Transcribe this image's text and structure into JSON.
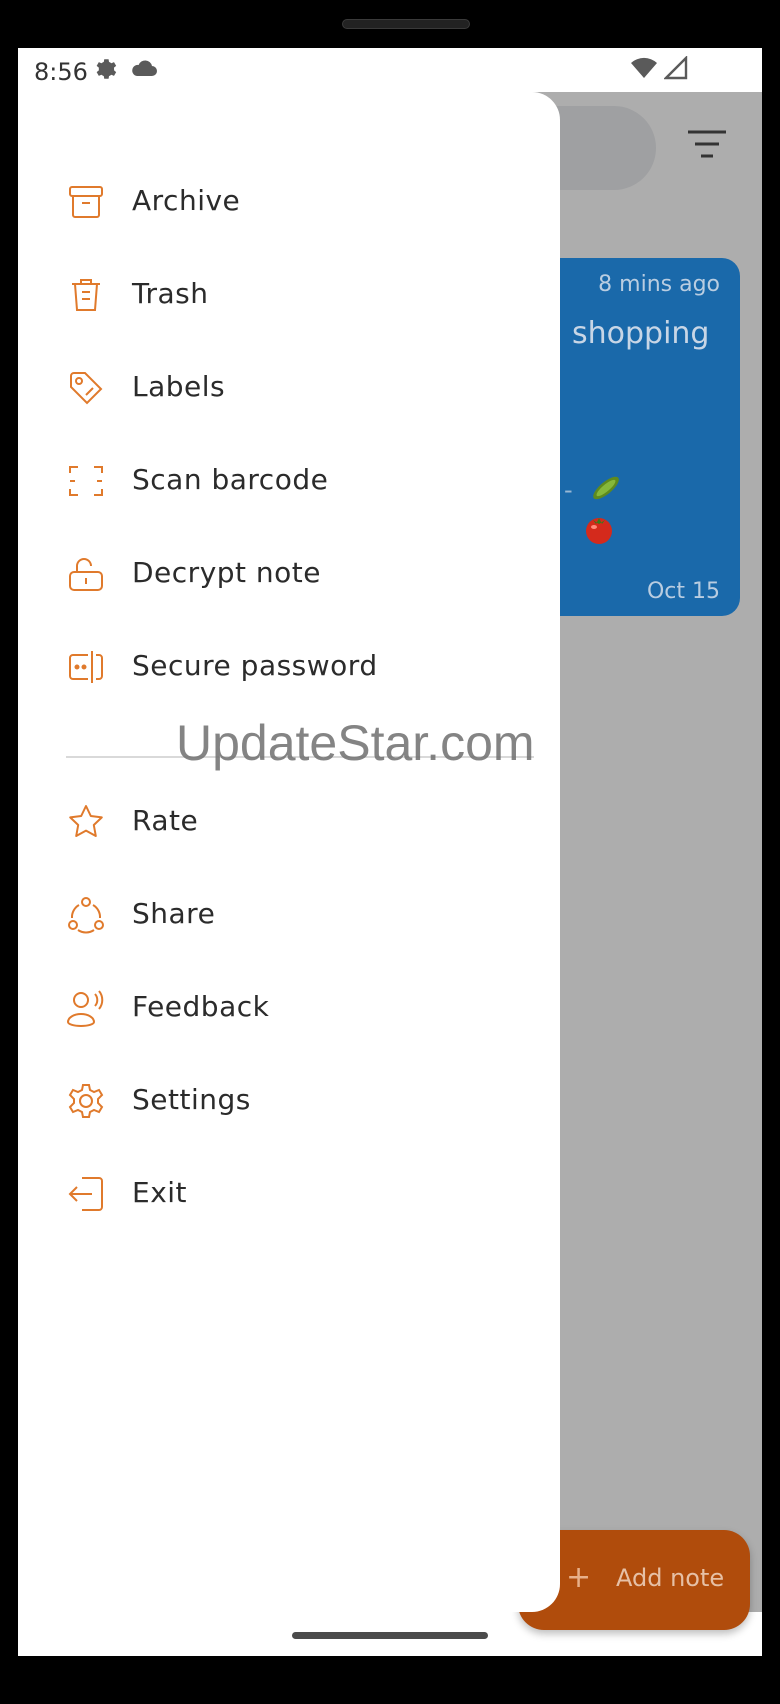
{
  "status": {
    "time": "8:56"
  },
  "menu": {
    "primary": [
      {
        "label": "Archive",
        "icon": "archive-icon"
      },
      {
        "label": "Trash",
        "icon": "trash-icon"
      },
      {
        "label": "Labels",
        "icon": "tag-icon"
      },
      {
        "label": "Scan barcode",
        "icon": "barcode-scan-icon"
      },
      {
        "label": "Decrypt note",
        "icon": "unlock-icon"
      },
      {
        "label": "Secure password",
        "icon": "password-icon"
      }
    ],
    "secondary": [
      {
        "label": "Rate",
        "icon": "star-icon"
      },
      {
        "label": "Share",
        "icon": "share-icon"
      },
      {
        "label": "Feedback",
        "icon": "feedback-icon"
      },
      {
        "label": "Settings",
        "icon": "gear-icon"
      },
      {
        "label": "Exit",
        "icon": "exit-icon"
      }
    ]
  },
  "note": {
    "time": "8 mins ago",
    "title": "shopping",
    "date": "Oct 15"
  },
  "fab": {
    "label": "Add note",
    "plus": "+"
  },
  "watermark": "UpdateStar.com",
  "colors": {
    "accent": "#e07a2c",
    "note_card": "#1a69aa",
    "fab": "#b04c0c"
  }
}
